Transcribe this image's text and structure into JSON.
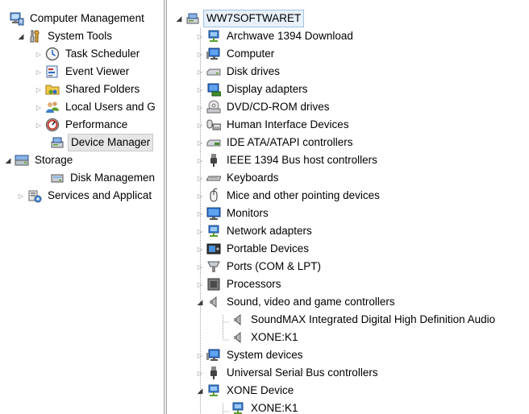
{
  "left_tree": {
    "root": {
      "label": "Computer Management",
      "icon": "computer-management-icon"
    },
    "system_tools": {
      "label": "System Tools",
      "icon": "tools-icon"
    },
    "task_scheduler": {
      "label": "Task Scheduler",
      "icon": "clock-icon"
    },
    "event_viewer": {
      "label": "Event Viewer",
      "icon": "event-viewer-icon"
    },
    "shared_folders": {
      "label": "Shared Folders",
      "icon": "shared-folder-icon"
    },
    "local_users": {
      "label": "Local Users and G",
      "icon": "users-icon"
    },
    "performance": {
      "label": "Performance",
      "icon": "performance-icon"
    },
    "device_manager": {
      "label": "Device Manager",
      "icon": "device-manager-icon"
    },
    "storage": {
      "label": "Storage",
      "icon": "storage-icon"
    },
    "disk_management": {
      "label": "Disk Managemen",
      "icon": "disk-icon"
    },
    "services": {
      "label": "Services and Applicat",
      "icon": "services-icon"
    }
  },
  "device_tree": {
    "root": {
      "label": "WW7SOFTWARET"
    },
    "categories": [
      {
        "label": "Archwave 1394 Download",
        "icon": "network-icon"
      },
      {
        "label": "Computer",
        "icon": "monitor-icon"
      },
      {
        "label": "Disk drives",
        "icon": "disk-drive-icon"
      },
      {
        "label": "Display adapters",
        "icon": "display-adapter-icon"
      },
      {
        "label": "DVD/CD-ROM drives",
        "icon": "dvd-icon"
      },
      {
        "label": "Human Interface Devices",
        "icon": "hid-icon"
      },
      {
        "label": "IDE ATA/ATAPI controllers",
        "icon": "ide-icon"
      },
      {
        "label": "IEEE 1394 Bus host controllers",
        "icon": "plug-icon"
      },
      {
        "label": "Keyboards",
        "icon": "keyboard-icon"
      },
      {
        "label": "Mice and other pointing devices",
        "icon": "mouse-icon"
      },
      {
        "label": "Monitors",
        "icon": "monitor-icon"
      },
      {
        "label": "Network adapters",
        "icon": "network-icon"
      },
      {
        "label": "Portable Devices",
        "icon": "portable-device-icon"
      },
      {
        "label": "Ports (COM & LPT)",
        "icon": "port-icon"
      },
      {
        "label": "Processors",
        "icon": "processor-icon"
      },
      {
        "label": "Sound, video and game controllers",
        "icon": "speaker-icon"
      },
      {
        "label": "SoundMAX Integrated Digital High Definition Audio",
        "icon": "speaker-icon"
      },
      {
        "label": "XONE:K1",
        "icon": "speaker-icon"
      },
      {
        "label": "System devices",
        "icon": "monitor-icon"
      },
      {
        "label": "Universal Serial Bus controllers",
        "icon": "usb-icon"
      },
      {
        "label": "XONE Device",
        "icon": "network-icon"
      },
      {
        "label": "XONE:K1",
        "icon": "network-icon"
      }
    ]
  },
  "colors": {
    "selection": "#e6e6e6",
    "root_selection": "#e8f1fb",
    "accent_blue": "#2a6ac8"
  }
}
